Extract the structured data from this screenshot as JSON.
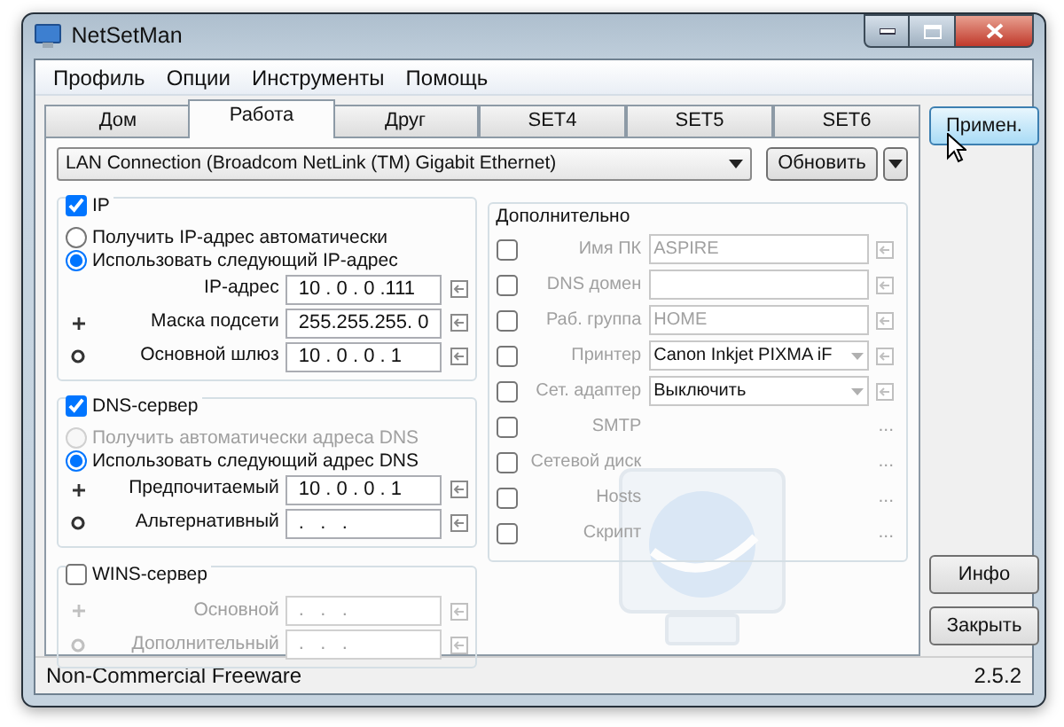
{
  "window": {
    "title": "NetSetMan"
  },
  "menu": [
    "Профиль",
    "Опции",
    "Инструменты",
    "Помощь"
  ],
  "tabs": [
    {
      "label": "Дом",
      "selected": false
    },
    {
      "label": "Работа",
      "selected": true
    },
    {
      "label": "Друг",
      "selected": false
    },
    {
      "label": "SET4",
      "selected": false
    },
    {
      "label": "SET5",
      "selected": false
    },
    {
      "label": "SET6",
      "selected": false
    }
  ],
  "connection": {
    "value": "LAN Connection (Broadcom NetLink (TM) Gigabit Ethernet)"
  },
  "refresh_button": "Обновить",
  "ip_group": {
    "label": "IP",
    "checked": true,
    "options": [
      {
        "label": "Получить IP-адрес автоматически",
        "selected": false,
        "disabled": false
      },
      {
        "label": "Использовать следующий IP-адрес",
        "selected": true,
        "disabled": false
      }
    ],
    "fields": [
      {
        "label": "IP-адрес",
        "value": "10 . 0 . 0 .111"
      },
      {
        "label": "Маска подсети",
        "value": "255.255.255. 0"
      },
      {
        "label": "Основной шлюз",
        "value": "10 . 0 . 0 . 1"
      }
    ]
  },
  "dns_group": {
    "label": "DNS-сервер",
    "checked": true,
    "options": [
      {
        "label": "Получить автоматически адреса DNS",
        "selected": false,
        "disabled": true
      },
      {
        "label": "Использовать следующий адрес DNS",
        "selected": true,
        "disabled": false
      }
    ],
    "fields": [
      {
        "label": "Предпочитаемый",
        "value": "10 . 0 . 0 . 1"
      },
      {
        "label": "Альтернативный",
        "value": ".   .   ."
      }
    ]
  },
  "wins_group": {
    "label": "WINS-сервер",
    "checked": false,
    "fields": [
      {
        "label": "Основной",
        "value": ".   .   ."
      },
      {
        "label": "Дополнительный",
        "value": ".   .   ."
      }
    ]
  },
  "extra_group": {
    "title": "Дополнительно",
    "rows": [
      {
        "kind": "text",
        "label": "Имя ПК",
        "checked": false,
        "value": "ASPIRE"
      },
      {
        "kind": "text",
        "label": "DNS домен",
        "checked": false
      },
      {
        "kind": "text",
        "label": "Раб. группа",
        "checked": false,
        "value": "HOME"
      },
      {
        "kind": "select",
        "label": "Принтер",
        "checked": false,
        "value": "Canon Inkjet PIXMA iF"
      },
      {
        "kind": "select",
        "label": "Сет. адаптер",
        "checked": false,
        "value": "Выключить"
      },
      {
        "kind": "dots",
        "label": "SMTP",
        "checked": false,
        "button": "..."
      },
      {
        "kind": "dots",
        "label": "Сетевой диск",
        "checked": false,
        "button": "..."
      },
      {
        "kind": "dots",
        "label": "Hosts",
        "checked": false,
        "button": "..."
      },
      {
        "kind": "dots",
        "label": "Скрипт",
        "checked": false,
        "button": "..."
      }
    ]
  },
  "side_buttons": [
    {
      "label": "Примен.",
      "highlighted": true
    },
    {
      "label": "Инфо",
      "highlighted": false
    },
    {
      "label": "Закрыть",
      "highlighted": false
    }
  ],
  "status_bar": {
    "text": "Non-Commercial Freeware",
    "version": "2.5.2"
  }
}
